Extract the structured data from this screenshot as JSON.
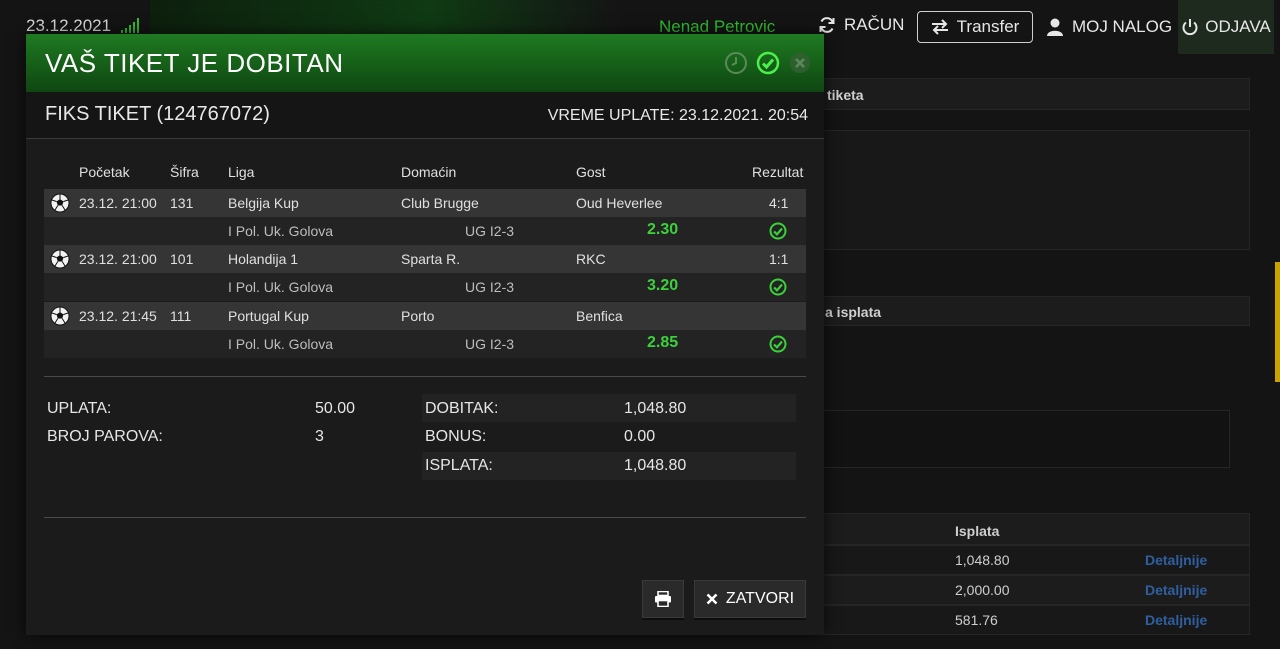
{
  "topbar": {
    "date": "23.12.2021",
    "username": "Nenad Petrovic",
    "racun": "RAČUN",
    "transfer": "Transfer",
    "moj_nalog": "MOJ NALOG",
    "odjava": "ODJAVA"
  },
  "background": {
    "row1_label": "tiketa",
    "row2_label": "a isplata",
    "isplata_header": "Isplata",
    "rows": [
      {
        "amount": "1,048.80",
        "link": "Detaljnije"
      },
      {
        "amount": "2,000.00",
        "link": "Detaljnije"
      },
      {
        "amount": "581.76",
        "link": "Detaljnije"
      }
    ]
  },
  "modal": {
    "title": "VAŠ TIKET JE DOBITAN",
    "ticket_title": "FIKS TIKET (124767072)",
    "vreme_uplate": "VREME UPLATE: 23.12.2021. 20:54",
    "columns": {
      "pocetak": "Početak",
      "sifra": "Šifra",
      "liga": "Liga",
      "domacin": "Domaćin",
      "gost": "Gost",
      "rezultat": "Rezultat"
    },
    "matches": [
      {
        "start": "23.12. 21:00",
        "code": "131",
        "league": "Belgija Kup",
        "home": "Club Brugge",
        "away": "Oud Heverlee",
        "result": "4:1",
        "bet_type": "I Pol. Uk. Golova",
        "bet_pick": "UG I2-3",
        "odd": "2.30"
      },
      {
        "start": "23.12. 21:00",
        "code": "101",
        "league": "Holandija 1",
        "home": "Sparta R.",
        "away": "RKC",
        "result": "1:1",
        "bet_type": "I Pol. Uk. Golova",
        "bet_pick": "UG I2-3",
        "odd": "3.20"
      },
      {
        "start": "23.12. 21:45",
        "code": "111",
        "league": "Portugal Kup",
        "home": "Porto",
        "away": "Benfica",
        "result": "",
        "bet_type": "I Pol. Uk. Golova",
        "bet_pick": "UG I2-3",
        "odd": "2.85"
      }
    ],
    "summary": {
      "uplata_label": "UPLATA:",
      "uplata": "50.00",
      "broj_parova_label": "BROJ PAROVA:",
      "broj_parova": "3",
      "dobitak_label": "DOBITAK:",
      "dobitak": "1,048.80",
      "bonus_label": "BONUS:",
      "bonus": "0.00",
      "isplata_label": "ISPLATA:",
      "isplata": "1,048.80"
    },
    "buttons": {
      "print_icon": "printer-icon",
      "close_label": "ZATVORI"
    }
  },
  "colors": {
    "accent_green": "#3cd03c",
    "header_green": "#1f7a22",
    "link_blue": "#2f5fa0"
  }
}
